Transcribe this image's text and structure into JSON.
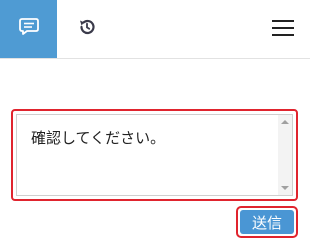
{
  "header": {
    "tabs": [
      {
        "icon": "chat-icon",
        "active": true
      },
      {
        "icon": "history-icon",
        "active": false
      }
    ],
    "menu_icon": "hamburger-menu-icon"
  },
  "message": {
    "value": "確認してください。"
  },
  "send": {
    "label": "送信"
  },
  "colors": {
    "accent": "#4f9bd3",
    "highlight": "#e0242e"
  }
}
